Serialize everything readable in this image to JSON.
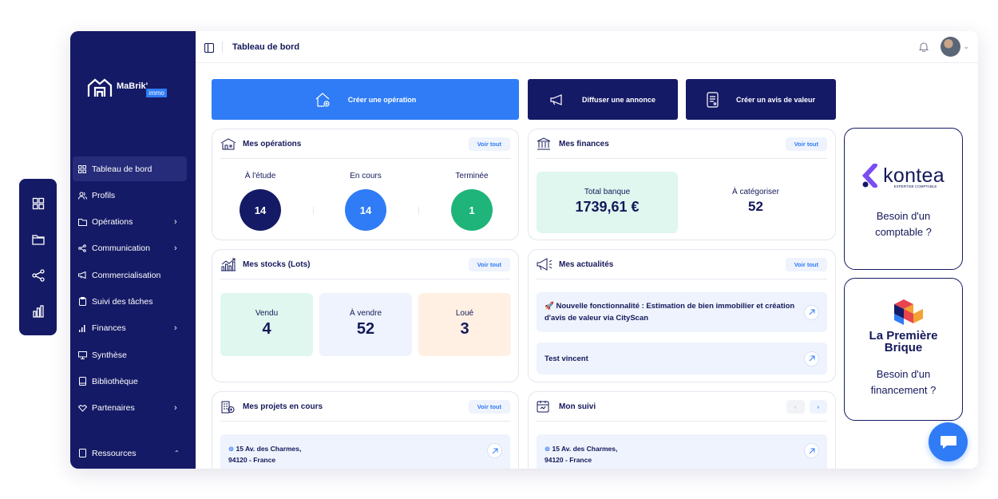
{
  "colors": {
    "navy": "#151a66",
    "blue": "#2f7cf6",
    "green": "#1eb47a",
    "mint": "#dff7ee",
    "lightblue": "#eef3fd",
    "peach": "#fff0e3"
  },
  "rail": {
    "icons": [
      "grid-icon",
      "folder-icon",
      "share-icon",
      "chart-icon"
    ]
  },
  "logo": {
    "name": "MaBrik'",
    "badge": "immo"
  },
  "sidebar": {
    "items": [
      {
        "label": "Tableau de bord",
        "icon": "grid-icon"
      },
      {
        "label": "Profils",
        "icon": "users-icon"
      },
      {
        "label": "Opérations",
        "icon": "folder-icon"
      },
      {
        "label": "Communication",
        "icon": "share-icon"
      },
      {
        "label": "Commercialisation",
        "icon": "megaphone-icon"
      },
      {
        "label": "Suivi des tâches",
        "icon": "clipboard-icon"
      },
      {
        "label": "Finances",
        "icon": "bars-icon"
      },
      {
        "label": "Synthèse",
        "icon": "monitor-icon"
      },
      {
        "label": "Bibliothèque",
        "icon": "book-icon"
      },
      {
        "label": "Partenaires",
        "icon": "handshake-icon"
      }
    ],
    "resources": "Ressources"
  },
  "header": {
    "title": "Tableau de bord"
  },
  "actions": {
    "create_operation": "Créer une opération",
    "post_ad": "Diffuser une annonce",
    "create_valuation": "Créer un avis de valeur"
  },
  "see_all": "Voir tout",
  "operations": {
    "title": "Mes opérations",
    "study": {
      "label": "À l'étude",
      "value": "14"
    },
    "ongoing": {
      "label": "En cours",
      "value": "14"
    },
    "done": {
      "label": "Terminée",
      "value": "1"
    }
  },
  "finances": {
    "title": "Mes finances",
    "bank": {
      "label": "Total banque",
      "value": "1739,61 €"
    },
    "categorize": {
      "label": "À catégoriser",
      "value": "52"
    }
  },
  "stocks": {
    "title": "Mes stocks (Lots)",
    "sold": {
      "label": "Vendu",
      "value": "4"
    },
    "for_sale": {
      "label": "À vendre",
      "value": "52"
    },
    "rented": {
      "label": "Loué",
      "value": "3"
    }
  },
  "news": {
    "title": "Mes actualités",
    "items": [
      "🚀 Nouvelle fonctionnalité : Estimation de bien immobilier et création d'avis de valeur via CityScan",
      "Test vincent"
    ]
  },
  "projects": {
    "title": "Mes projets en cours",
    "address_line1": "15 Av. des Charmes,",
    "address_line2": "94120 - France"
  },
  "tracking": {
    "title": "Mon suivi",
    "address_line1": "15 Av. des Charmes,",
    "address_line2": "94120 - France"
  },
  "promo_kontea": {
    "brand": "kontea",
    "tagline": "EXPERTISE COMPTABLE",
    "text_line1": "Besoin d'un",
    "text_line2": "comptable ?"
  },
  "promo_brique": {
    "brand_line1": "La Première",
    "brand_line2": "Brique",
    "text_line1": "Besoin d'un",
    "text_line2": "financement ?"
  }
}
